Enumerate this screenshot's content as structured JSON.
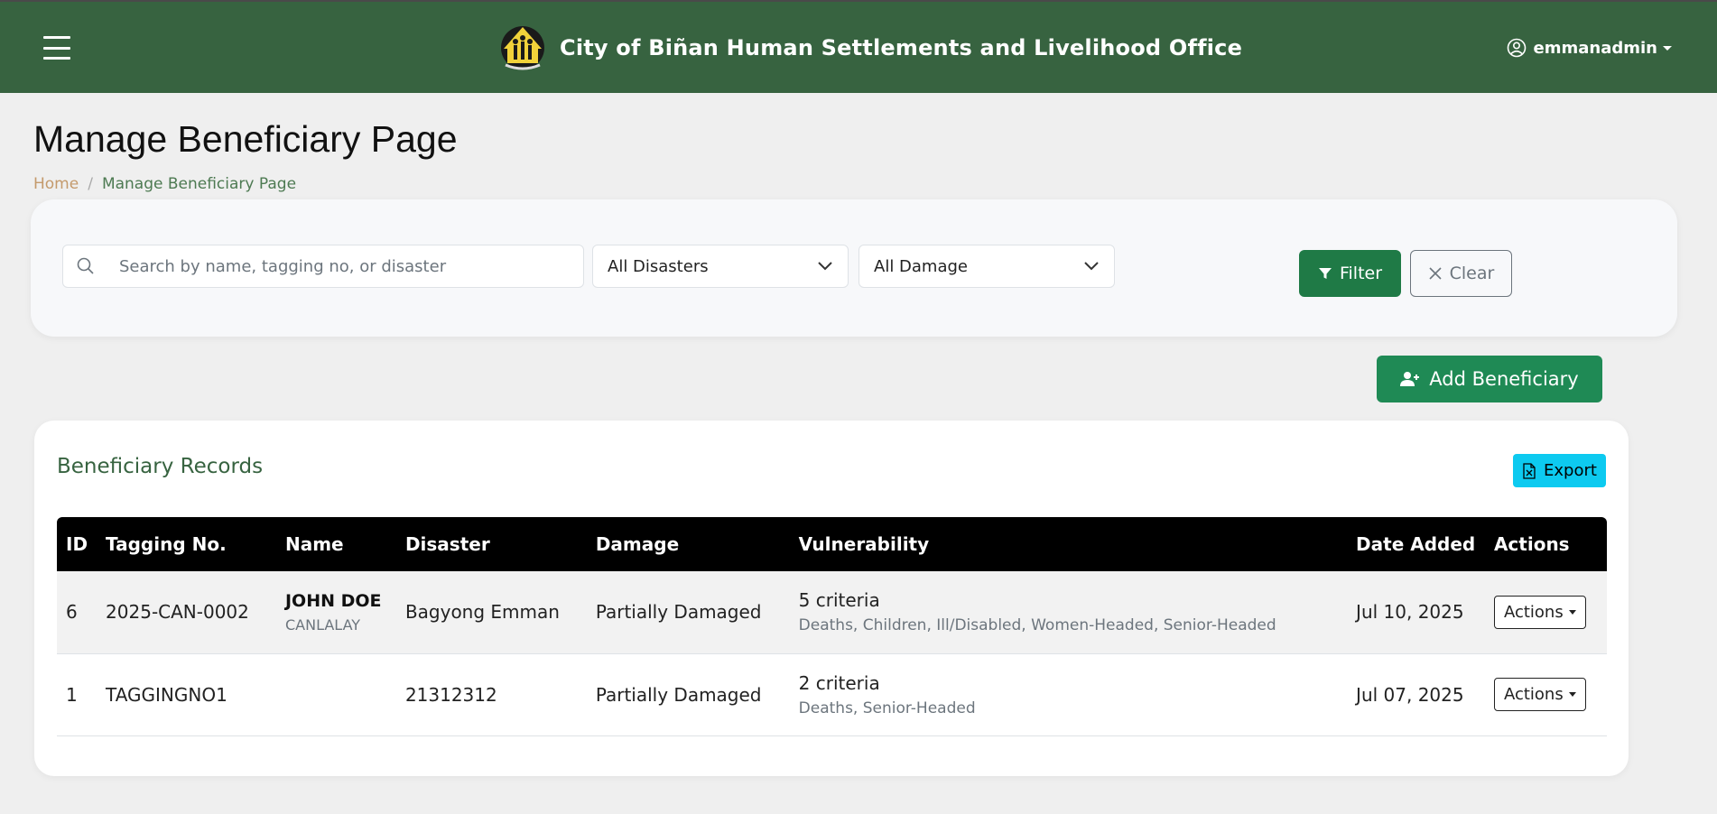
{
  "header": {
    "title": "City of Biñan Human Settlements and Livelihood Office",
    "username": "emmanadmin"
  },
  "page": {
    "title": "Manage Beneficiary Page",
    "breadcrumb": {
      "home": "Home",
      "separator": "/",
      "current": "Manage Beneficiary Page"
    }
  },
  "filters": {
    "search_placeholder": "Search by name, tagging no, or disaster",
    "disaster_select": "All Disasters",
    "damage_select": "All Damage",
    "filter_label": "Filter",
    "clear_label": "Clear"
  },
  "add_button_label": "Add Beneficiary",
  "records": {
    "title": "Beneficiary Records",
    "export_label": "Export",
    "columns": [
      "ID",
      "Tagging No.",
      "Name",
      "Disaster",
      "Damage",
      "Vulnerability",
      "Date Added",
      "Actions"
    ],
    "rows": [
      {
        "id": "6",
        "tagging_no": "2025-CAN-0002",
        "name": "JOHN DOE",
        "barangay": "CANLALAY",
        "disaster": "Bagyong Emman",
        "damage": "Partially Damaged",
        "vulnerability_count": "5 criteria",
        "vulnerability_list": "Deaths, Children, Ill/Disabled, Women-Headed, Senior-Headed",
        "date_added": "Jul 10, 2025",
        "actions_label": "Actions"
      },
      {
        "id": "1",
        "tagging_no": "TAGGINGNO1",
        "name": "",
        "barangay": "",
        "disaster": "21312312",
        "damage": "Partially Damaged",
        "vulnerability_count": "2 criteria",
        "vulnerability_list": "Deaths, Senior-Headed",
        "date_added": "Jul 07, 2025",
        "actions_label": "Actions"
      }
    ]
  },
  "colors": {
    "header_bg": "#376340",
    "primary_green": "#1f7a46",
    "export_cyan": "#0dcaf0",
    "table_header_bg": "#000000"
  }
}
